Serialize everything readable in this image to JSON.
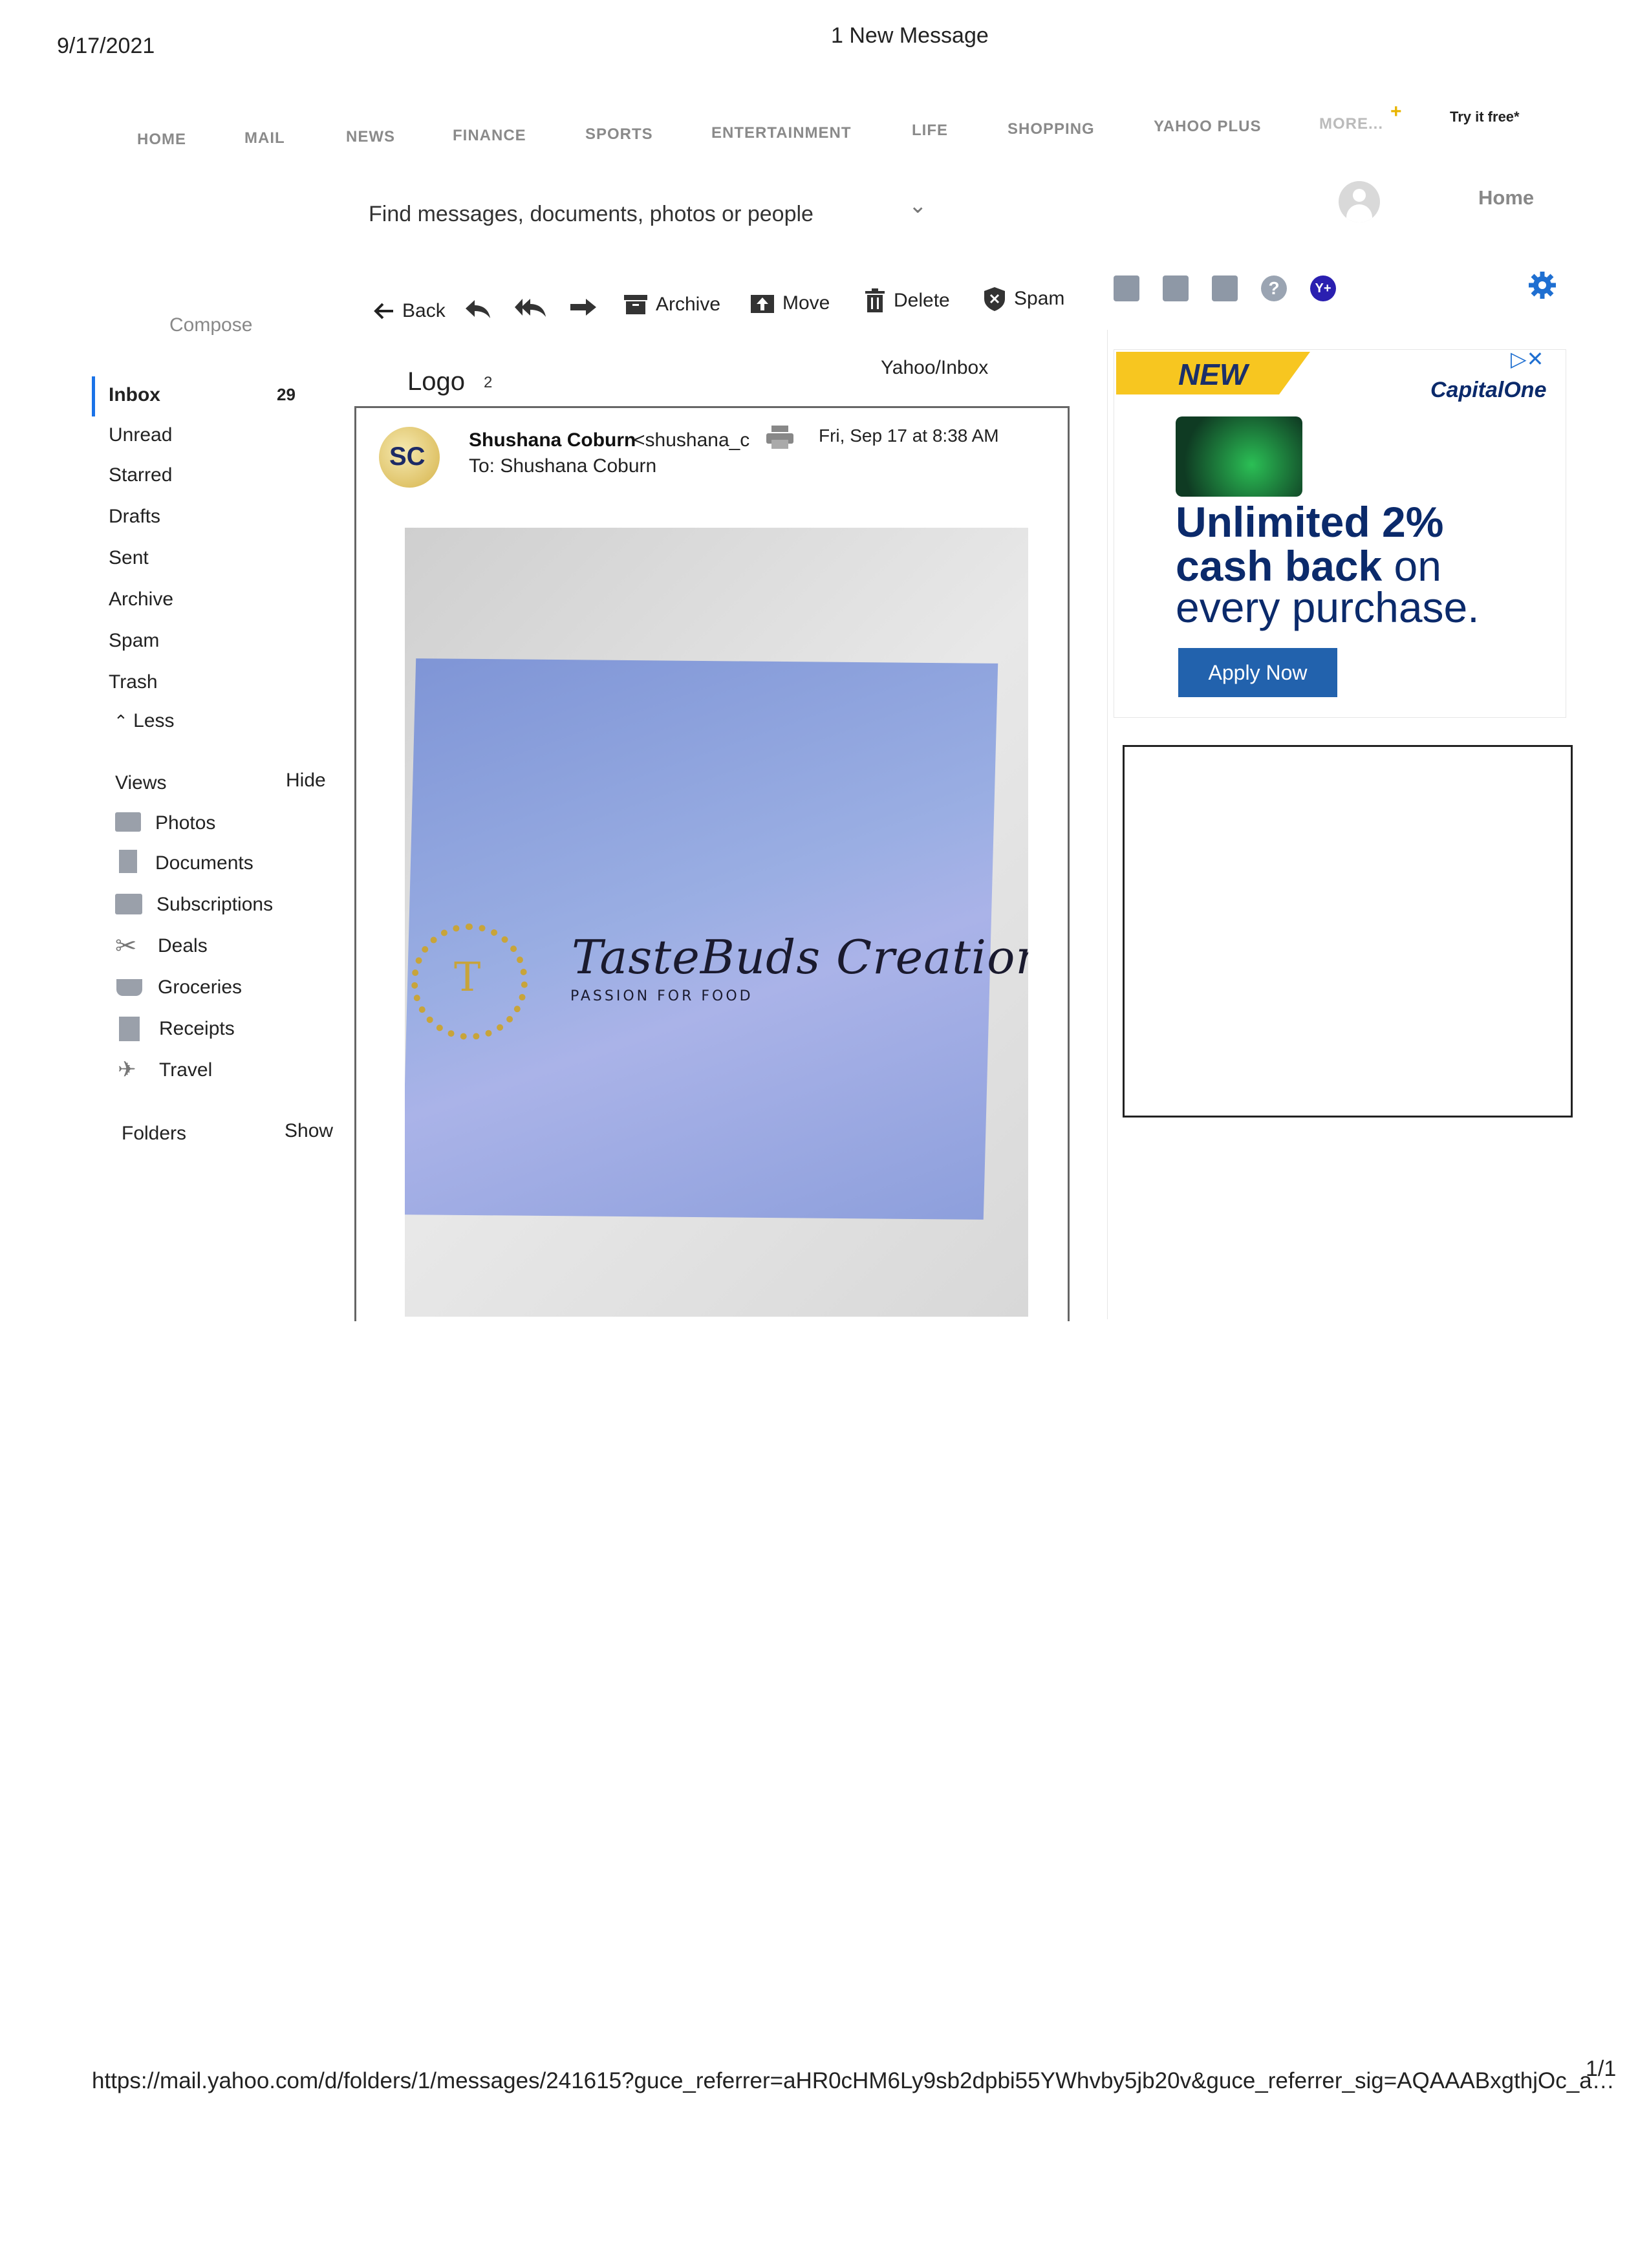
{
  "print": {
    "date": "9/17/2021",
    "title": "1 New Message",
    "url": "https://mail.yahoo.com/d/folders/1/messages/241615?guce_referrer=aHR0cHM6Ly9sb2dpbi55YWhvby5jb20v&guce_referrer_sig=AQAAABxgthjOc_a…",
    "page": "1/1"
  },
  "nav": {
    "items": [
      "HOME",
      "MAIL",
      "NEWS",
      "FINANCE",
      "SPORTS",
      "ENTERTAINMENT",
      "LIFE",
      "SHOPPING",
      "YAHOO PLUS",
      "MORE..."
    ],
    "try_free": "Try it free*"
  },
  "search": {
    "placeholder": "Find messages, documents, photos or people",
    "home": "Home"
  },
  "toolbar": {
    "compose": "Compose",
    "back": "Back",
    "archive": "Archive",
    "move": "Move",
    "delete": "Delete",
    "spam": "Spam"
  },
  "sidebar": {
    "folders": [
      {
        "label": "Inbox",
        "count": "29"
      },
      {
        "label": "Unread"
      },
      {
        "label": "Starred"
      },
      {
        "label": "Drafts"
      },
      {
        "label": "Sent"
      },
      {
        "label": "Archive"
      },
      {
        "label": "Spam"
      },
      {
        "label": "Trash"
      }
    ],
    "less": "Less",
    "views_label": "Views",
    "views_toggle": "Hide",
    "views": [
      "Photos",
      "Documents",
      "Subscriptions",
      "Deals",
      "Groceries",
      "Receipts",
      "Travel"
    ],
    "folders_label": "Folders",
    "folders_toggle": "Show"
  },
  "message": {
    "subject": "Logo",
    "thread_count": "2",
    "folder_path": "Yahoo/Inbox",
    "sender_initials": "SC",
    "sender_name": "Shushana Coburn",
    "sender_email": "<shushana_c",
    "date": "Fri, Sep 17 at 8:38 AM",
    "to": "To: Shushana Coburn",
    "logo_text": "TasteBuds Creations, LLC",
    "logo_tagline": "PASSION FOR FOOD",
    "logo_monogram": "T"
  },
  "ad": {
    "badge": "NEW",
    "brand": "CapitalOne",
    "headline_1": "Unlimited 2%",
    "headline_2_bold": "cash back",
    "headline_2_rest": " on",
    "headline_3": "every purchase.",
    "cta": "Apply Now",
    "colors": {
      "badge": "#f7c620",
      "navy": "#0b2a6b",
      "cta": "#2262ad"
    }
  }
}
